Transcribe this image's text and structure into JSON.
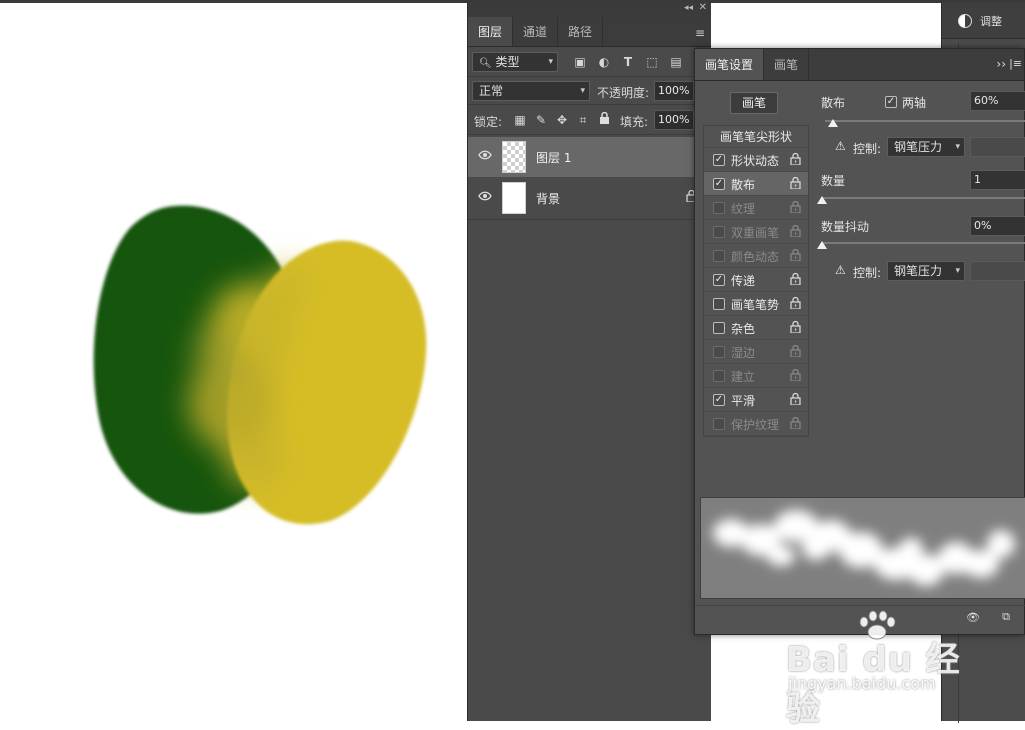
{
  "layers_panel": {
    "tabs": [
      "图层",
      "通道",
      "路径"
    ],
    "active_tab": 0,
    "filter_kind": "类型",
    "blend_mode": "正常",
    "opacity_label": "不透明度:",
    "opacity_value": "100%",
    "lock_label": "锁定:",
    "fill_label": "填充:",
    "fill_value": "100%",
    "layers": [
      {
        "name": "图层 1",
        "selected": true,
        "visible": true,
        "locked": false
      },
      {
        "name": "背景",
        "selected": false,
        "visible": true,
        "locked": true
      }
    ]
  },
  "right_panel": {
    "adjust_label": "调整"
  },
  "brush_panel": {
    "tabs": [
      "画笔设置",
      "画笔"
    ],
    "brush_button": "画笔",
    "list_header": "画笔笔尖形状",
    "items": [
      {
        "label": "形状动态",
        "checked": true,
        "enabled": true,
        "selected": false
      },
      {
        "label": "散布",
        "checked": true,
        "enabled": true,
        "selected": true
      },
      {
        "label": "纹理",
        "checked": false,
        "enabled": false,
        "selected": false
      },
      {
        "label": "双重画笔",
        "checked": false,
        "enabled": false,
        "selected": false
      },
      {
        "label": "颜色动态",
        "checked": false,
        "enabled": false,
        "selected": false
      },
      {
        "label": "传递",
        "checked": true,
        "enabled": true,
        "selected": false
      },
      {
        "label": "画笔笔势",
        "checked": false,
        "enabled": true,
        "selected": false
      },
      {
        "label": "杂色",
        "checked": false,
        "enabled": true,
        "selected": false
      },
      {
        "label": "湿边",
        "checked": false,
        "enabled": false,
        "selected": false
      },
      {
        "label": "建立",
        "checked": false,
        "enabled": false,
        "selected": false
      },
      {
        "label": "平滑",
        "checked": true,
        "enabled": true,
        "selected": false
      },
      {
        "label": "保护纹理",
        "checked": false,
        "enabled": false,
        "selected": false
      }
    ],
    "scatter_label": "散布",
    "both_axes_label": "两轴",
    "scatter_value": "60%",
    "control_label": "控制:",
    "control_value_1": "钢笔压力",
    "count_label": "数量",
    "count_value": "1",
    "count_jitter_label": "数量抖动",
    "count_jitter_value": "0%",
    "control_value_2": "钢笔压力"
  },
  "watermark": {
    "main": "Bai du 经验",
    "sub": "jingyan.baidu.com"
  },
  "colors": {
    "green": "#135510",
    "yellow": "#d6bd28",
    "panel": "#4a4a4a",
    "panel_dark": "#3c3c3c"
  }
}
